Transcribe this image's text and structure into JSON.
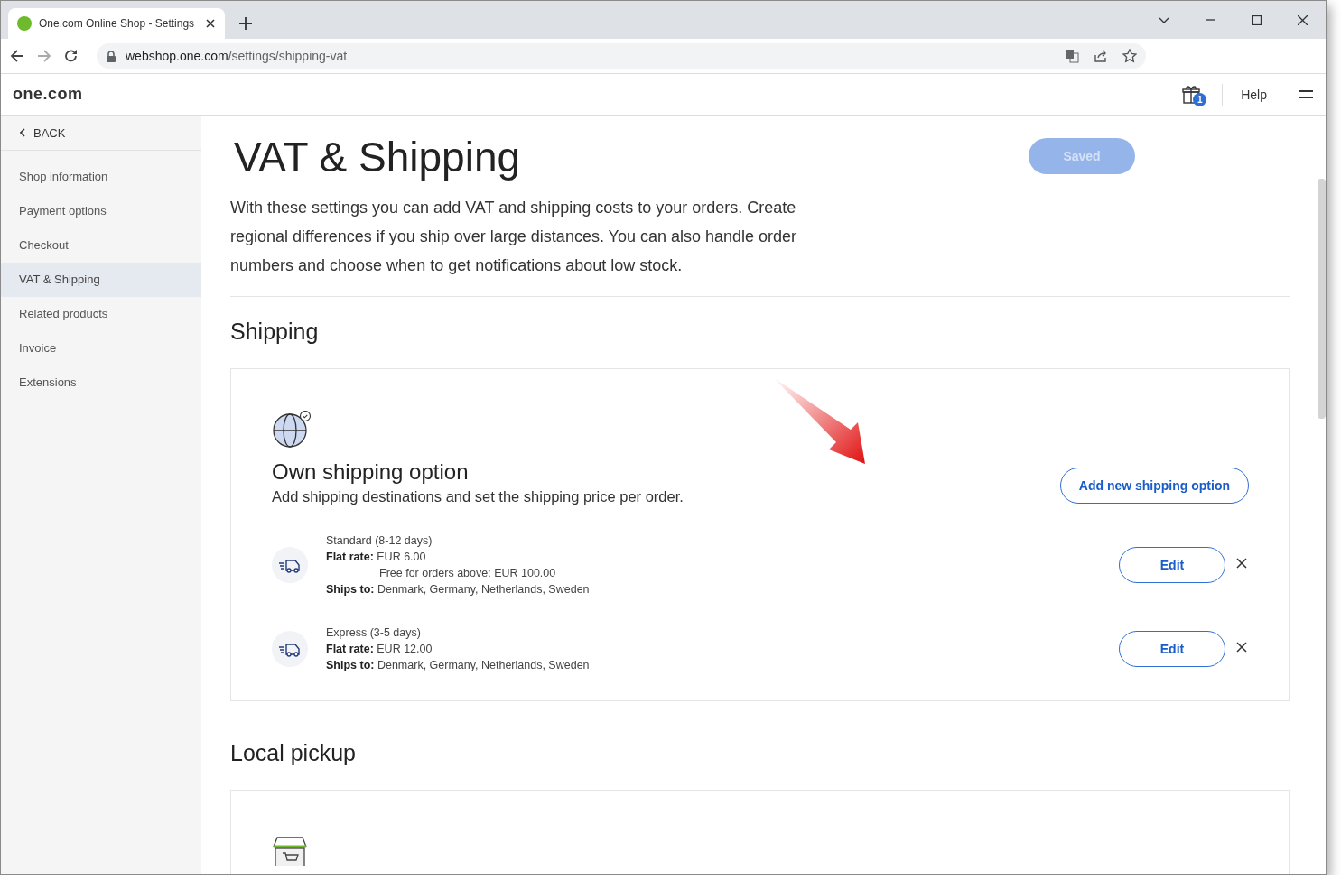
{
  "browser": {
    "tab_title": "One.com Online Shop - Settings",
    "url_host": "webshop.one.com",
    "url_path": "/settings/shipping-vat"
  },
  "header": {
    "logo": "one.com",
    "gift_count": "1",
    "help": "Help"
  },
  "sidebar": {
    "back": "BACK",
    "items": [
      {
        "label": "Shop information",
        "selected": false
      },
      {
        "label": "Payment options",
        "selected": false
      },
      {
        "label": "Checkout",
        "selected": false
      },
      {
        "label": "VAT & Shipping",
        "selected": true
      },
      {
        "label": "Related products",
        "selected": false
      },
      {
        "label": "Invoice",
        "selected": false
      },
      {
        "label": "Extensions",
        "selected": false
      }
    ]
  },
  "page": {
    "title": "VAT & Shipping",
    "save_button": {
      "label": "Saved",
      "disabled": true
    },
    "description": "With these settings you can add VAT and shipping costs to your orders. Create regional differences if you ship over large distances. You can also handle order numbers and choose when to get notifications about low stock."
  },
  "shipping": {
    "heading": "Shipping",
    "card_title": "Own shipping option",
    "card_text": "Add shipping destinations and set the shipping price per order.",
    "add_button": "Add new shipping option",
    "options": [
      {
        "name": "Standard (8-12 days)",
        "rate_label": "Flat rate:",
        "rate": "EUR 6.00",
        "free_note": "Free for orders above: EUR 100.00",
        "ships_label": "Ships to:",
        "ships_to": "Denmark, Germany, Netherlands, Sweden",
        "edit": "Edit"
      },
      {
        "name": "Express (3-5 days)",
        "rate_label": "Flat rate:",
        "rate": "EUR 12.00",
        "ships_label": "Ships to:",
        "ships_to": "Denmark, Germany, Netherlands, Sweden",
        "edit": "Edit"
      }
    ]
  },
  "local_pickup": {
    "heading": "Local pickup"
  }
}
